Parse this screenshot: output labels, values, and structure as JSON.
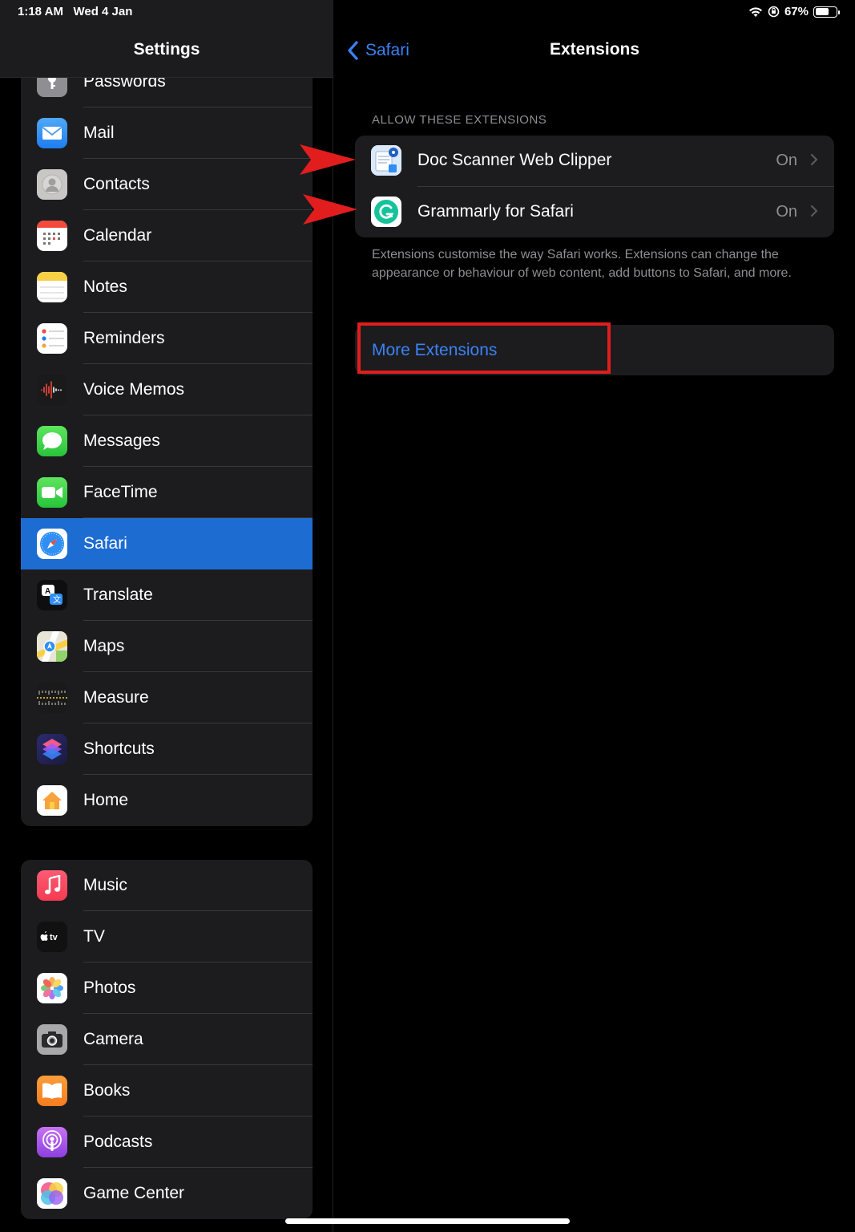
{
  "status_bar": {
    "time": "1:18 AM",
    "date": "Wed 4 Jan",
    "battery": "67%"
  },
  "sidebar": {
    "title": "Settings",
    "group1": [
      {
        "label": "Passwords",
        "icon": "key-icon"
      },
      {
        "label": "Mail",
        "icon": "mail-icon"
      },
      {
        "label": "Contacts",
        "icon": "contacts-icon"
      },
      {
        "label": "Calendar",
        "icon": "calendar-icon"
      },
      {
        "label": "Notes",
        "icon": "notes-icon"
      },
      {
        "label": "Reminders",
        "icon": "reminders-icon"
      },
      {
        "label": "Voice Memos",
        "icon": "voice-memos-icon"
      },
      {
        "label": "Messages",
        "icon": "messages-icon"
      },
      {
        "label": "FaceTime",
        "icon": "facetime-icon"
      },
      {
        "label": "Safari",
        "icon": "safari-icon",
        "selected": true
      },
      {
        "label": "Translate",
        "icon": "translate-icon"
      },
      {
        "label": "Maps",
        "icon": "maps-icon"
      },
      {
        "label": "Measure",
        "icon": "measure-icon"
      },
      {
        "label": "Shortcuts",
        "icon": "shortcuts-icon"
      },
      {
        "label": "Home",
        "icon": "home-icon"
      }
    ],
    "group2": [
      {
        "label": "Music",
        "icon": "music-icon"
      },
      {
        "label": "TV",
        "icon": "tv-icon"
      },
      {
        "label": "Photos",
        "icon": "photos-icon"
      },
      {
        "label": "Camera",
        "icon": "camera-icon"
      },
      {
        "label": "Books",
        "icon": "books-icon"
      },
      {
        "label": "Podcasts",
        "icon": "podcasts-icon"
      },
      {
        "label": "Game Center",
        "icon": "game-center-icon"
      }
    ]
  },
  "detail": {
    "back_label": "Safari",
    "title": "Extensions",
    "section_header": "ALLOW THESE EXTENSIONS",
    "extensions": [
      {
        "label": "Doc Scanner Web Clipper",
        "value": "On",
        "icon": "doc-scanner-icon"
      },
      {
        "label": "Grammarly for Safari",
        "value": "On",
        "icon": "grammarly-icon"
      }
    ],
    "footer": "Extensions customise the way Safari works. Extensions can change the appearance or behaviour of web content, add buttons to Safari, and more.",
    "more_label": "More Extensions"
  },
  "colors": {
    "accent": "#3b82f6",
    "selected": "#1d6cd2",
    "annotation": "#e11d1d"
  }
}
